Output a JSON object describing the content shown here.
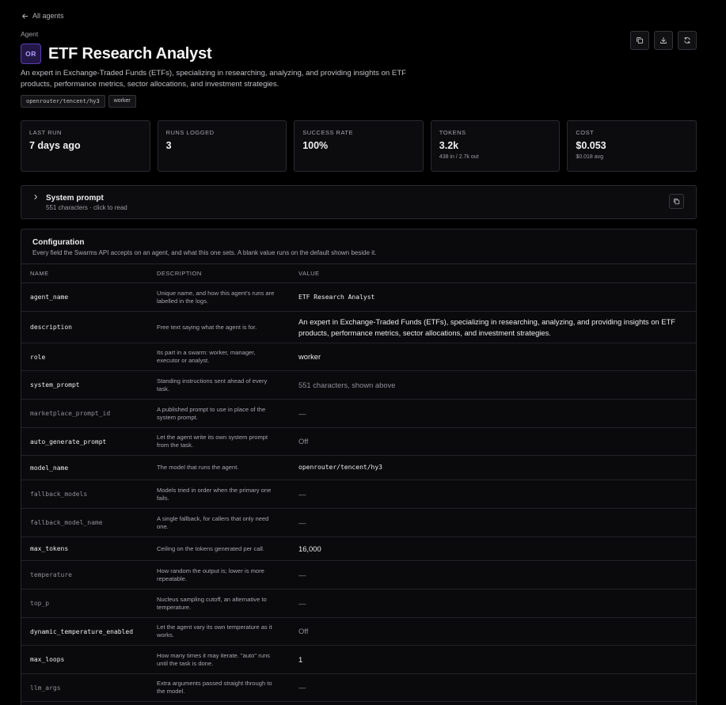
{
  "nav": {
    "back_label": "All agents"
  },
  "header": {
    "eyebrow": "Agent",
    "avatar_initials": "OR",
    "title": "ETF Research Analyst",
    "description": "An expert in Exchange-Traded Funds (ETFs), specializing in researching, analyzing, and providing insights on ETF products, performance metrics, sector allocations, and investment strategies.",
    "tags": [
      "openrouter/tencent/hy3",
      "worker"
    ],
    "actions": [
      "copy-icon",
      "download-icon",
      "refresh-icon"
    ]
  },
  "stats": [
    {
      "label": "Last run",
      "value": "7 days ago",
      "sub": ""
    },
    {
      "label": "Runs logged",
      "value": "3",
      "sub": ""
    },
    {
      "label": "Success rate",
      "value": "100%",
      "sub": ""
    },
    {
      "label": "Tokens",
      "value": "3.2k",
      "sub": "438 in / 2.7k out"
    },
    {
      "label": "Cost",
      "value": "$0.053",
      "sub": "$0.018 avg"
    }
  ],
  "system_prompt": {
    "title": "System prompt",
    "subtitle": "551 characters · click to read"
  },
  "config": {
    "title": "Configuration",
    "subtitle": "Every field the Swarms API accepts on an agent, and what this one sets. A blank value runs on the default shown beside it.",
    "columns": [
      "Name",
      "Description",
      "Value"
    ],
    "rows": [
      {
        "name": "agent_name",
        "desc": "Unique name, and how this agent's runs are labelled in the logs.",
        "value": "ETF Research Analyst",
        "style": "mono",
        "set": true
      },
      {
        "name": "description",
        "desc": "Free text saying what the agent is for.",
        "value": "An expert in Exchange-Traded Funds (ETFs), specializing in researching, analyzing, and providing insights on ETF products, performance metrics, sector allocations, and investment strategies.",
        "style": "text",
        "set": true
      },
      {
        "name": "role",
        "desc": "Its part in a swarm: worker, manager, executor or analyst.",
        "value": "worker",
        "style": "text",
        "set": true
      },
      {
        "name": "system_prompt",
        "desc": "Standing instructions sent ahead of every task.",
        "value": "551 characters, shown above",
        "style": "muted",
        "set": true
      },
      {
        "name": "marketplace_prompt_id",
        "desc": "A published prompt to use in place of the system prompt.",
        "value": "—",
        "style": "muted",
        "set": false
      },
      {
        "name": "auto_generate_prompt",
        "desc": "Let the agent write its own system prompt from the task.",
        "value": "Off",
        "style": "muted",
        "set": true
      },
      {
        "name": "model_name",
        "desc": "The model that runs the agent.",
        "value": "openrouter/tencent/hy3",
        "style": "mono",
        "set": true
      },
      {
        "name": "fallback_models",
        "desc": "Models tried in order when the primary one fails.",
        "value": "—",
        "style": "muted",
        "set": false
      },
      {
        "name": "fallback_model_name",
        "desc": "A single fallback, for callers that only need one.",
        "value": "—",
        "style": "muted",
        "set": false
      },
      {
        "name": "max_tokens",
        "desc": "Ceiling on the tokens generated per call.",
        "value": "16,000",
        "style": "text",
        "set": true
      },
      {
        "name": "temperature",
        "desc": "How random the output is; lower is more repeatable.",
        "value": "—",
        "style": "muted",
        "set": false
      },
      {
        "name": "top_p",
        "desc": "Nucleus sampling cutoff, an alternative to temperature.",
        "value": "—",
        "style": "muted",
        "set": false
      },
      {
        "name": "dynamic_temperature_enabled",
        "desc": "Let the agent vary its own temperature as it works.",
        "value": "Off",
        "style": "muted",
        "set": true
      },
      {
        "name": "max_loops",
        "desc": "How many times it may iterate. \"auto\" runs until the task is done.",
        "value": "1",
        "style": "text",
        "set": true
      },
      {
        "name": "llm_args",
        "desc": "Extra arguments passed straight through to the model.",
        "value": "—",
        "style": "muted",
        "set": false
      },
      {
        "name": "",
        "desc": "",
        "value": "",
        "style": "muted",
        "set": false
      }
    ]
  }
}
